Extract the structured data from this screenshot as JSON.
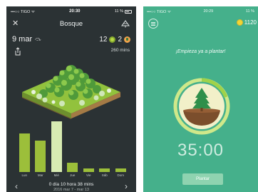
{
  "left_screen": {
    "status": {
      "carrier": "•••○○ TIGO ᯤ",
      "time": "20:30",
      "battery": "11 %"
    },
    "nav": {
      "title": "Bosque"
    },
    "date": "9 mar",
    "counts": {
      "healthy": "12",
      "dead": "2"
    },
    "total_mins": "260 mins",
    "chart_data": {
      "type": "bar",
      "categories": [
        "Lun",
        "Mar",
        "Mié",
        "Jue",
        "Vie",
        "Sáb",
        "Dom"
      ],
      "values": [
        82,
        67,
        108,
        20,
        7,
        7,
        7
      ],
      "highlight_index": 2,
      "colors": {
        "bar": "#9cbf3a",
        "highlight": "#d8ecb2"
      }
    },
    "summary": "0 día 10 hora 38 mins",
    "range": "2016 mar 7 - mar 13"
  },
  "right_screen": {
    "status": {
      "carrier": "•••○○ TIGO ᯤ",
      "time": "20:29",
      "battery": "11 %"
    },
    "coins": "1120",
    "prompt": "¡Empieza ya a plantar!",
    "timer": "35:00",
    "plant_button": "Plantar"
  }
}
